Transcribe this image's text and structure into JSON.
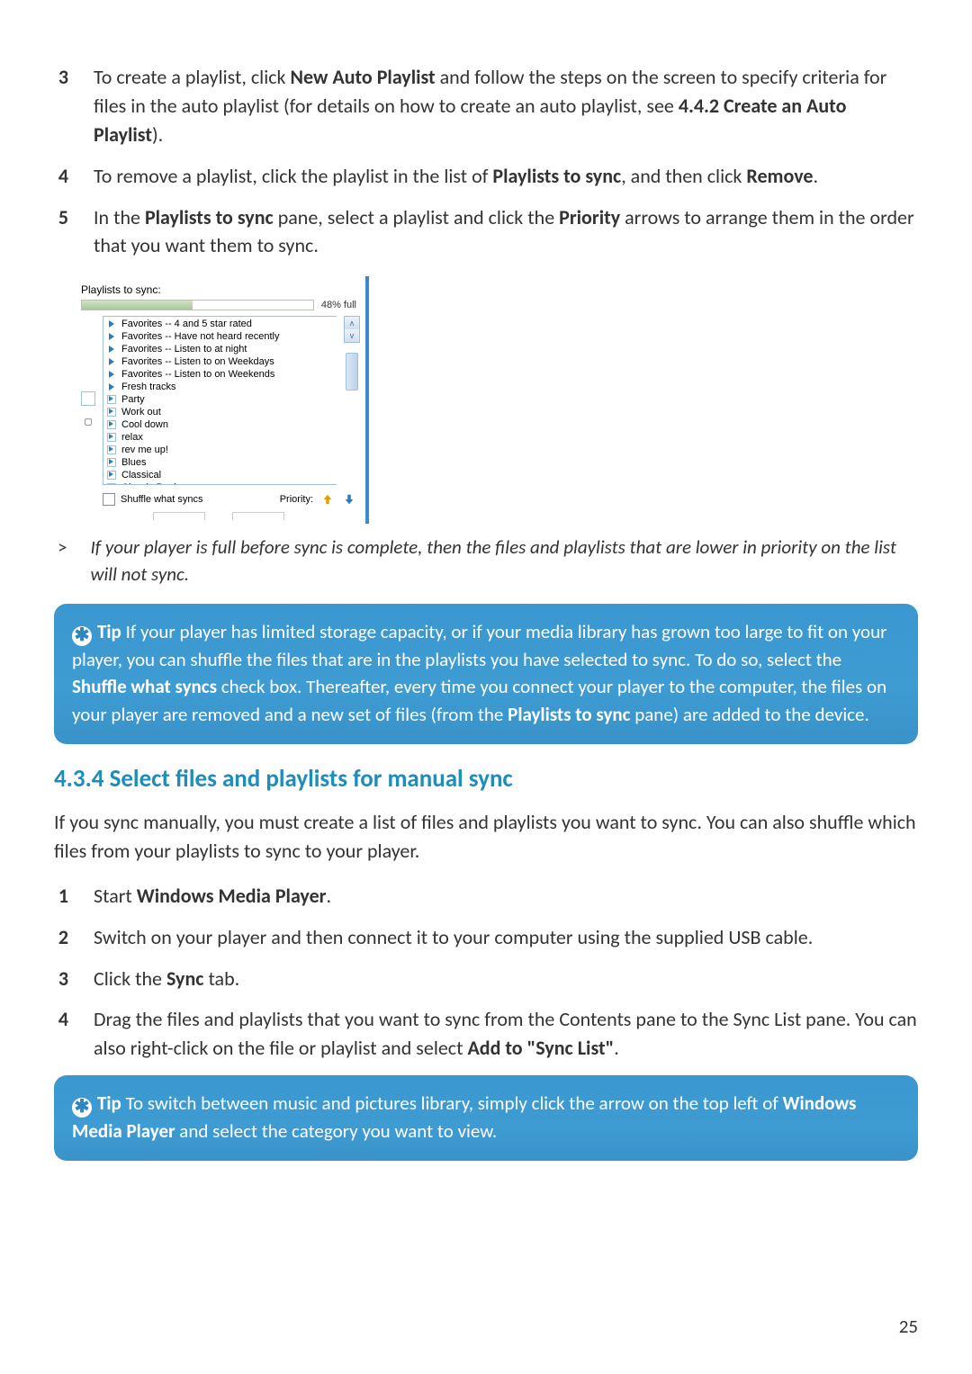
{
  "steps_a": [
    {
      "n": "3",
      "segments": [
        "To create a playlist, click ",
        [
          "b",
          "New Auto Playlist"
        ],
        " and follow the steps on the screen to specify criteria for files in the auto playlist (for details on how to create an auto playlist, see ",
        [
          "b",
          "4.4.2 Create an Auto Playlist"
        ],
        ")."
      ]
    },
    {
      "n": "4",
      "segments": [
        "To remove a playlist, click the playlist in the list of ",
        [
          "b",
          "Playlists to sync"
        ],
        ", and then click ",
        [
          "b",
          "Remove"
        ],
        "."
      ]
    },
    {
      "n": "5",
      "segments": [
        "In the ",
        [
          "b",
          "Playlists to sync"
        ],
        " pane, select a playlist and click the ",
        [
          "b",
          "Priority"
        ],
        " arrows to arrange them in the order that you want them to sync."
      ]
    }
  ],
  "shot": {
    "title": "Playlists to sync:",
    "full": "48% full",
    "items": [
      {
        "icon": "open",
        "label": "Favorites -- 4 and 5 star rated"
      },
      {
        "icon": "open",
        "label": "Favorites -- Have not heard recently"
      },
      {
        "icon": "open",
        "label": "Favorites -- Listen to at night"
      },
      {
        "icon": "open",
        "label": "Favorites -- Listen to on Weekdays"
      },
      {
        "icon": "open",
        "label": "Favorites -- Listen to on Weekends"
      },
      {
        "icon": "open",
        "label": "Fresh tracks"
      },
      {
        "icon": "box",
        "label": "Party"
      },
      {
        "icon": "box",
        "label": "Work out"
      },
      {
        "icon": "box",
        "label": "Cool down"
      },
      {
        "icon": "box",
        "label": "relax"
      },
      {
        "icon": "box",
        "label": "rev me up!"
      },
      {
        "icon": "box",
        "label": "Blues"
      },
      {
        "icon": "box",
        "label": "Classical"
      },
      {
        "icon": "box",
        "label": "Classic Rock"
      }
    ],
    "shuffle": "Shuffle what syncs",
    "priority": "Priority:"
  },
  "note": {
    "marker": ">",
    "text": "If your player is full before sync is complete, then the files and playlists that are lower in priority on the list will not sync."
  },
  "tip1": {
    "icon": "✱",
    "label": "Tip",
    "segments": [
      " If your player has limited storage capacity, or if your media library has grown too large to fit on your player, you can shuffle the files that are in the playlists you have selected to sync. To do so, select the ",
      [
        "b",
        "Shuffle what syncs"
      ],
      " check box. Thereafter, every time you connect your player to the computer, the files on your player are removed and a new set of files (from the ",
      [
        "b",
        "Playlists to sync"
      ],
      " pane) are added to the device."
    ]
  },
  "section": "4.3.4 Select files and playlists for manual sync",
  "lead": "If you sync manually, you must create a list of files and playlists you want to sync. You can also shuffle which files from your playlists to sync to your player.",
  "steps_b": [
    {
      "n": "1",
      "segments": [
        "Start ",
        [
          "b",
          "Windows Media Player"
        ],
        "."
      ]
    },
    {
      "n": "2",
      "segments": [
        "Switch on your player and then connect it to your computer using the supplied USB cable."
      ]
    },
    {
      "n": "3",
      "segments": [
        "Click the ",
        [
          "b",
          "Sync"
        ],
        " tab."
      ]
    },
    {
      "n": "4",
      "segments": [
        "Drag the files and playlists that you want to sync from the Contents pane to the Sync List pane. You can also right-click on the file or playlist and select ",
        [
          "b",
          "Add to \"Sync List\""
        ],
        "."
      ]
    }
  ],
  "tip2": {
    "icon": "✱",
    "label": "Tip",
    "segments": [
      " To switch between music and pictures library, simply click the arrow on the top left of ",
      [
        "b",
        "Windows Media Player"
      ],
      " and select the category you want to view."
    ]
  },
  "page_number": "25"
}
